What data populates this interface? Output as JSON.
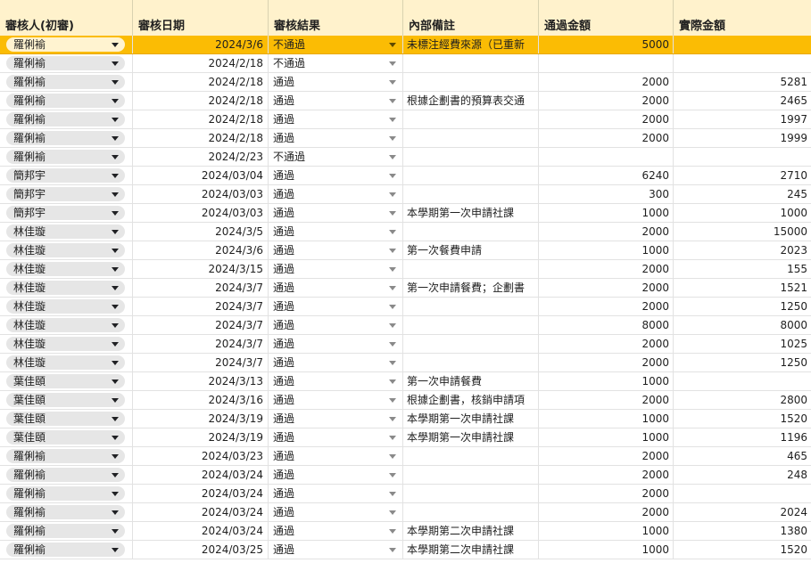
{
  "headers": [
    "審核人(初審)",
    "審核日期",
    "審核結果",
    "內部備註",
    "通過金額",
    "實際金額"
  ],
  "rows": [
    {
      "reviewer": "羅俐褕",
      "date": "2024/3/6",
      "result": "不通過",
      "note": "未標注經費來源（已重新",
      "approved": "5000",
      "actual": "",
      "selected": true
    },
    {
      "reviewer": "羅俐褕",
      "date": "2024/2/18",
      "result": "不通過",
      "note": "",
      "approved": "",
      "actual": ""
    },
    {
      "reviewer": "羅俐褕",
      "date": "2024/2/18",
      "result": "通過",
      "note": "",
      "approved": "2000",
      "actual": "5281"
    },
    {
      "reviewer": "羅俐褕",
      "date": "2024/2/18",
      "result": "通過",
      "note": "根據企劃書的預算表交通",
      "approved": "2000",
      "actual": "2465"
    },
    {
      "reviewer": "羅俐褕",
      "date": "2024/2/18",
      "result": "通過",
      "note": "",
      "approved": "2000",
      "actual": "1997"
    },
    {
      "reviewer": "羅俐褕",
      "date": "2024/2/18",
      "result": "通過",
      "note": "",
      "approved": "2000",
      "actual": "1999"
    },
    {
      "reviewer": "羅俐褕",
      "date": "2024/2/23",
      "result": "不通過",
      "note": "",
      "approved": "",
      "actual": ""
    },
    {
      "reviewer": "簡邦宇",
      "date": "2024/03/04",
      "result": "通過",
      "note": "",
      "approved": "6240",
      "actual": "2710"
    },
    {
      "reviewer": "簡邦宇",
      "date": "2024/03/03",
      "result": "通過",
      "note": "",
      "approved": "300",
      "actual": "245"
    },
    {
      "reviewer": "簡邦宇",
      "date": "2024/03/03",
      "result": "通過",
      "note": "本學期第一次申請社課",
      "approved": "1000",
      "actual": "1000"
    },
    {
      "reviewer": "林佳璇",
      "date": "2024/3/5",
      "result": "通過",
      "note": "",
      "approved": "2000",
      "actual": "15000"
    },
    {
      "reviewer": "林佳璇",
      "date": "2024/3/6",
      "result": "通過",
      "note": "第一次餐費申請",
      "approved": "1000",
      "actual": "2023"
    },
    {
      "reviewer": "林佳璇",
      "date": "2024/3/15",
      "result": "通過",
      "note": "",
      "approved": "2000",
      "actual": "155"
    },
    {
      "reviewer": "林佳璇",
      "date": "2024/3/7",
      "result": "通過",
      "note": "第一次申請餐費；企劃書",
      "approved": "2000",
      "actual": "1521"
    },
    {
      "reviewer": "林佳璇",
      "date": "2024/3/7",
      "result": "通過",
      "note": "",
      "approved": "2000",
      "actual": "1250"
    },
    {
      "reviewer": "林佳璇",
      "date": "2024/3/7",
      "result": "通過",
      "note": "",
      "approved": "8000",
      "actual": "8000"
    },
    {
      "reviewer": "林佳璇",
      "date": "2024/3/7",
      "result": "通過",
      "note": "",
      "approved": "2000",
      "actual": "1025"
    },
    {
      "reviewer": "林佳璇",
      "date": "2024/3/7",
      "result": "通過",
      "note": "",
      "approved": "2000",
      "actual": "1250"
    },
    {
      "reviewer": "葉佳頤",
      "date": "2024/3/13",
      "result": "通過",
      "note": "第一次申請餐費",
      "approved": "1000",
      "actual": ""
    },
    {
      "reviewer": "葉佳頤",
      "date": "2024/3/16",
      "result": "通過",
      "note": "根據企劃書，核銷申請項",
      "approved": "2000",
      "actual": "2800"
    },
    {
      "reviewer": "葉佳頤",
      "date": "2024/3/19",
      "result": "通過",
      "note": "本學期第一次申請社課",
      "approved": "1000",
      "actual": "1520"
    },
    {
      "reviewer": "葉佳頤",
      "date": "2024/3/19",
      "result": "通過",
      "note": "本學期第一次申請社課",
      "approved": "1000",
      "actual": "1196"
    },
    {
      "reviewer": "羅俐褕",
      "date": "2024/03/23",
      "result": "通過",
      "note": "",
      "approved": "2000",
      "actual": "465"
    },
    {
      "reviewer": "羅俐褕",
      "date": "2024/03/24",
      "result": "通過",
      "note": "",
      "approved": "2000",
      "actual": "248"
    },
    {
      "reviewer": "羅俐褕",
      "date": "2024/03/24",
      "result": "通過",
      "note": "",
      "approved": "2000",
      "actual": ""
    },
    {
      "reviewer": "羅俐褕",
      "date": "2024/03/24",
      "result": "通過",
      "note": "",
      "approved": "2000",
      "actual": "2024"
    },
    {
      "reviewer": "羅俐褕",
      "date": "2024/03/24",
      "result": "通過",
      "note": "本學期第二次申請社課",
      "approved": "1000",
      "actual": "1380"
    },
    {
      "reviewer": "羅俐褕",
      "date": "2024/03/25",
      "result": "通過",
      "note": "本學期第二次申請社課",
      "approved": "1000",
      "actual": "1520"
    }
  ],
  "colors": {
    "header_bg": "#fff2cc",
    "selected_row": "#fbbc04",
    "chip_bg": "#e6e6e6"
  }
}
